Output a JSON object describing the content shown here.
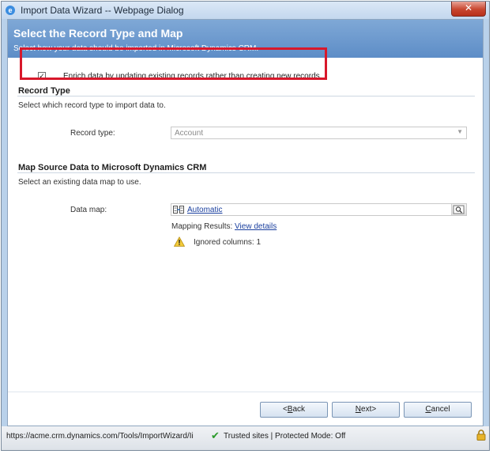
{
  "window": {
    "title": "Import Data Wizard -- Webpage Dialog",
    "close_glyph": "✕"
  },
  "banner": {
    "heading": "Select the Record Type and Map",
    "subheading": "Select how your data should be imported in Microsoft Dynamics CRM."
  },
  "enrich": {
    "checked": true,
    "check_glyph": "✓",
    "label": "Enrich data by updating existing records rather than creating new records."
  },
  "record_type_section": {
    "heading": "Record Type",
    "description": "Select which record type to import data to.",
    "field_label": "Record type:",
    "selected_value": "Account"
  },
  "map_section": {
    "heading": "Map Source Data to Microsoft Dynamics CRM",
    "description": "Select an existing data map to use.",
    "field_label": "Data map:",
    "map_value": "Automatic",
    "mapping_results_label": "Mapping Results:",
    "view_details_link": "View details",
    "ignored_columns": "Ignored columns: 1"
  },
  "buttons": {
    "back_prefix": "<",
    "back_underlined": "B",
    "back_rest": "ack",
    "next_prefix": "",
    "next_underlined": "N",
    "next_rest": "ext>",
    "cancel_underlined": "C",
    "cancel_rest": "ancel"
  },
  "status_bar": {
    "url": "https://acme.crm.dynamics.com/Tools/ImportWizard/Ii",
    "check_glyph": "✔",
    "zone": "Trusted sites | Protected Mode: Off"
  },
  "colors": {
    "banner": "#6f9ad0",
    "highlight_box": "#d8182b",
    "link": "#1a3f9e"
  },
  "icons": [
    "ie-icon",
    "close-icon",
    "checkbox-icon",
    "dropdown-arrow-icon",
    "data-map-icon",
    "lookup-icon",
    "warning-icon",
    "trusted-check-icon",
    "lock-icon"
  ]
}
